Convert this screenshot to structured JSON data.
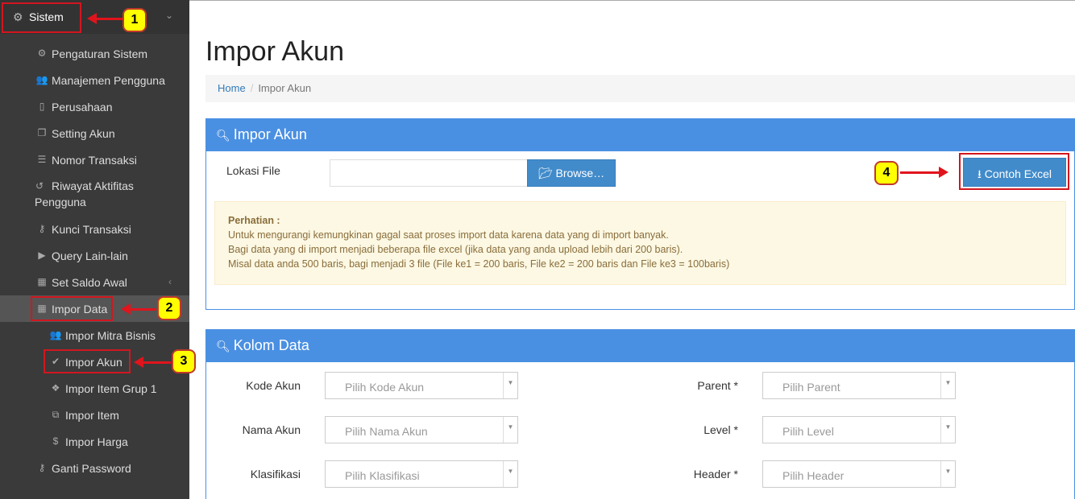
{
  "sidebar": {
    "title": "Sistem",
    "items": [
      {
        "label": "Pengaturan Sistem",
        "icon": "gear-icon"
      },
      {
        "label": "Manajemen Pengguna",
        "icon": "users-icon"
      },
      {
        "label": "Perusahaan",
        "icon": "clipboard-icon"
      },
      {
        "label": "Setting Akun",
        "icon": "copy-icon"
      },
      {
        "label": "Nomor Transaksi",
        "icon": "list-icon"
      },
      {
        "label": "Riwayat Aktifitas",
        "label2": "Pengguna",
        "icon": "history-icon"
      },
      {
        "label": "Kunci Transaksi",
        "icon": "key-icon"
      },
      {
        "label": "Query Lain-lain",
        "icon": "play-icon"
      },
      {
        "label": "Set Saldo Awal",
        "icon": "table-icon"
      },
      {
        "label": "Impor Data",
        "icon": "table-icon"
      },
      {
        "label": "Impor Mitra Bisnis",
        "icon": "users-icon"
      },
      {
        "label": "Impor Akun",
        "icon": "check-icon"
      },
      {
        "label": "Impor Item Grup 1",
        "icon": "dropbox-icon"
      },
      {
        "label": "Impor Item",
        "icon": "cubes-icon"
      },
      {
        "label": "Impor Harga",
        "icon": "dollar-icon"
      },
      {
        "label": "Ganti Password",
        "icon": "key-icon"
      }
    ]
  },
  "annotations": {
    "m1": "1",
    "m2": "2",
    "m3": "3",
    "m4": "4"
  },
  "page": {
    "title": "Impor Akun"
  },
  "breadcrumb": {
    "home": "Home",
    "current": "Impor Akun"
  },
  "import_panel": {
    "title": "Impor Akun",
    "file_label": "Lokasi File",
    "browse_label": "Browse…",
    "example_label": "Contoh Excel",
    "alert_title": "Perhatian :",
    "alert_lines": [
      "Untuk mengurangi kemungkinan gagal saat proses import data karena data yang di import banyak.",
      "Bagi data yang di import menjadi beberapa file excel (jika data yang anda upload lebih dari 200 baris).",
      "Misal data anda 500 baris, bagi menjadi 3 file (File ke1 = 200 baris, File ke2 = 200 baris dan File ke3 = 100baris)"
    ]
  },
  "columns_panel": {
    "title": "Kolom Data",
    "left": [
      {
        "label": "Kode Akun",
        "placeholder": "Pilih Kode Akun"
      },
      {
        "label": "Nama Akun",
        "placeholder": "Pilih Nama Akun"
      },
      {
        "label": "Klasifikasi",
        "placeholder": "Pilih Klasifikasi"
      }
    ],
    "right": [
      {
        "label": "Parent *",
        "placeholder": "Pilih Parent"
      },
      {
        "label": "Level *",
        "placeholder": "Pilih Level"
      },
      {
        "label": "Header *",
        "placeholder": "Pilih Header"
      }
    ]
  },
  "colors": {
    "accent": "#4a90e2",
    "annotation_red": "#d2161f",
    "marker_yellow": "#ffff00"
  }
}
